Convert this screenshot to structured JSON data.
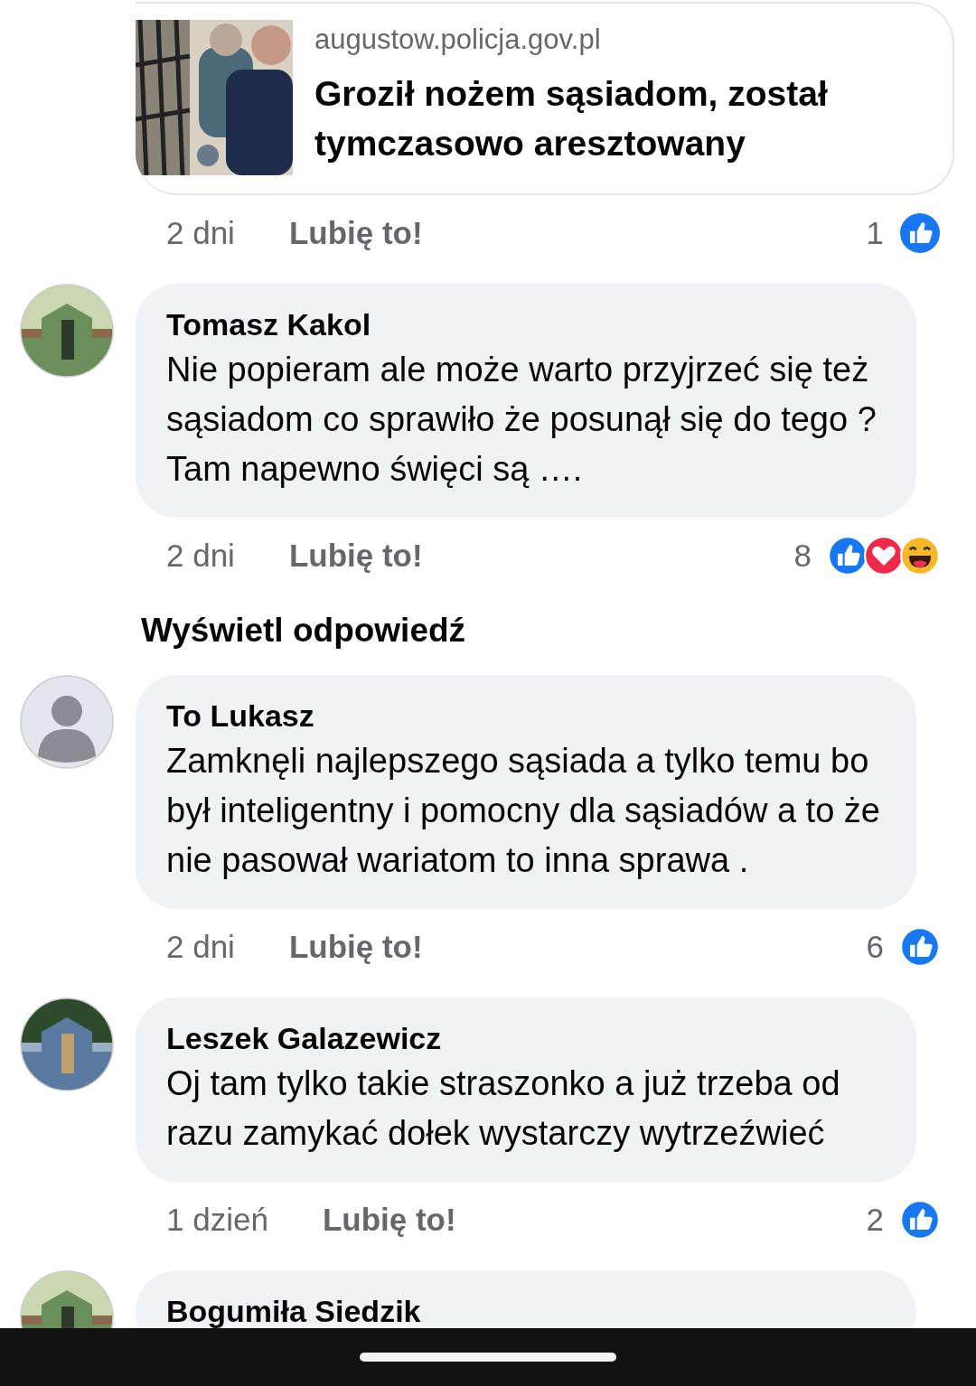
{
  "link_preview": {
    "domain": "augustow.policja.gov.pl",
    "title": "Groził nożem sąsiadom, został tymczasowo aresztowany",
    "image": {
      "kind": "picture"
    },
    "time": "2 dni",
    "like_label": "Lubię to!",
    "count": "1",
    "reactions": [
      {
        "kind": "like"
      }
    ]
  },
  "comments": [
    {
      "author": "Tomasz Kakol",
      "avatar": {
        "kind": "picture"
      },
      "text": "Nie popieram ale może warto przyjrzeć się też sąsiadom co sprawiło że posunął się do tego ? Tam napewno święci są ….",
      "time": "2 dni",
      "like_label": "Lubię to!",
      "count": "8",
      "reactions": [
        {
          "kind": "like"
        },
        {
          "kind": "love"
        },
        {
          "kind": "haha"
        }
      ],
      "view_replies": "Wyświetl odpowiedź"
    },
    {
      "author": "To Lukasz",
      "avatar": {
        "kind": "silhouette"
      },
      "text": "Zamknęli najlepszego sąsiada a tylko temu bo był inteligentny i pomocny dla sąsiadów a to że nie pasował wariatom to inna sprawa .",
      "time": "2 dni",
      "like_label": "Lubię to!",
      "count": "6",
      "reactions": [
        {
          "kind": "like"
        }
      ]
    },
    {
      "author": "Leszek Galazewicz",
      "avatar": {
        "kind": "picture"
      },
      "text": "Oj tam tylko takie straszonko a już trzeba od razu zamykać dołek wystarczy wytrzeźwieć",
      "time": "1 dzień",
      "like_label": "Lubię to!",
      "count": "2",
      "reactions": [
        {
          "kind": "like"
        }
      ]
    },
    {
      "author": "Bogumiła Siedzik",
      "avatar": {
        "kind": "picture"
      }
    }
  ]
}
